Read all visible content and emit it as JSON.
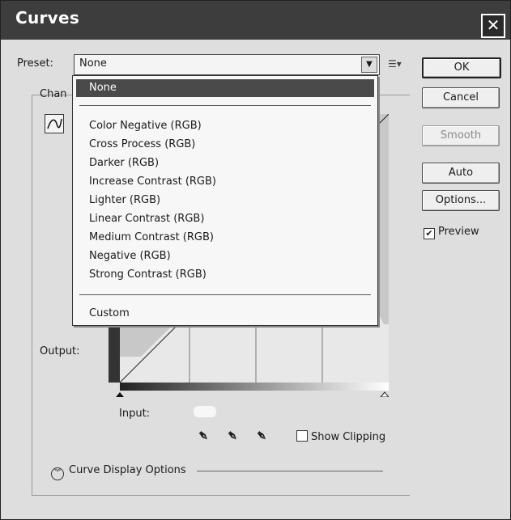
{
  "window": {
    "title": "Curves",
    "close_glyph": "✕"
  },
  "preset": {
    "label": "Preset:",
    "value": "None",
    "options": [
      "None",
      "Color Negative (RGB)",
      "Cross Process (RGB)",
      "Darker (RGB)",
      "Increase Contrast (RGB)",
      "Lighter (RGB)",
      "Linear Contrast (RGB)",
      "Medium Contrast (RGB)",
      "Negative (RGB)",
      "Strong Contrast (RGB)",
      "Custom"
    ],
    "selected_index": 0
  },
  "buttons": {
    "ok": "OK",
    "cancel": "Cancel",
    "smooth": "Smooth",
    "auto": "Auto",
    "options": "Options..."
  },
  "preview": {
    "label": "Preview",
    "checked": true
  },
  "channel_label": "Chan",
  "output_label": "Output:",
  "input_label": "Input:",
  "show_clipping": {
    "label": "Show Clipping",
    "checked": false
  },
  "curve_display_options": {
    "label": "Curve Display Options",
    "icon": "double-chevron-down-icon"
  },
  "icons": {
    "close": "close-icon",
    "dropdown_arrow": "chevron-down-icon",
    "preset_menu": "preset-options-icon",
    "eyedropper": "eyedropper-icon"
  }
}
